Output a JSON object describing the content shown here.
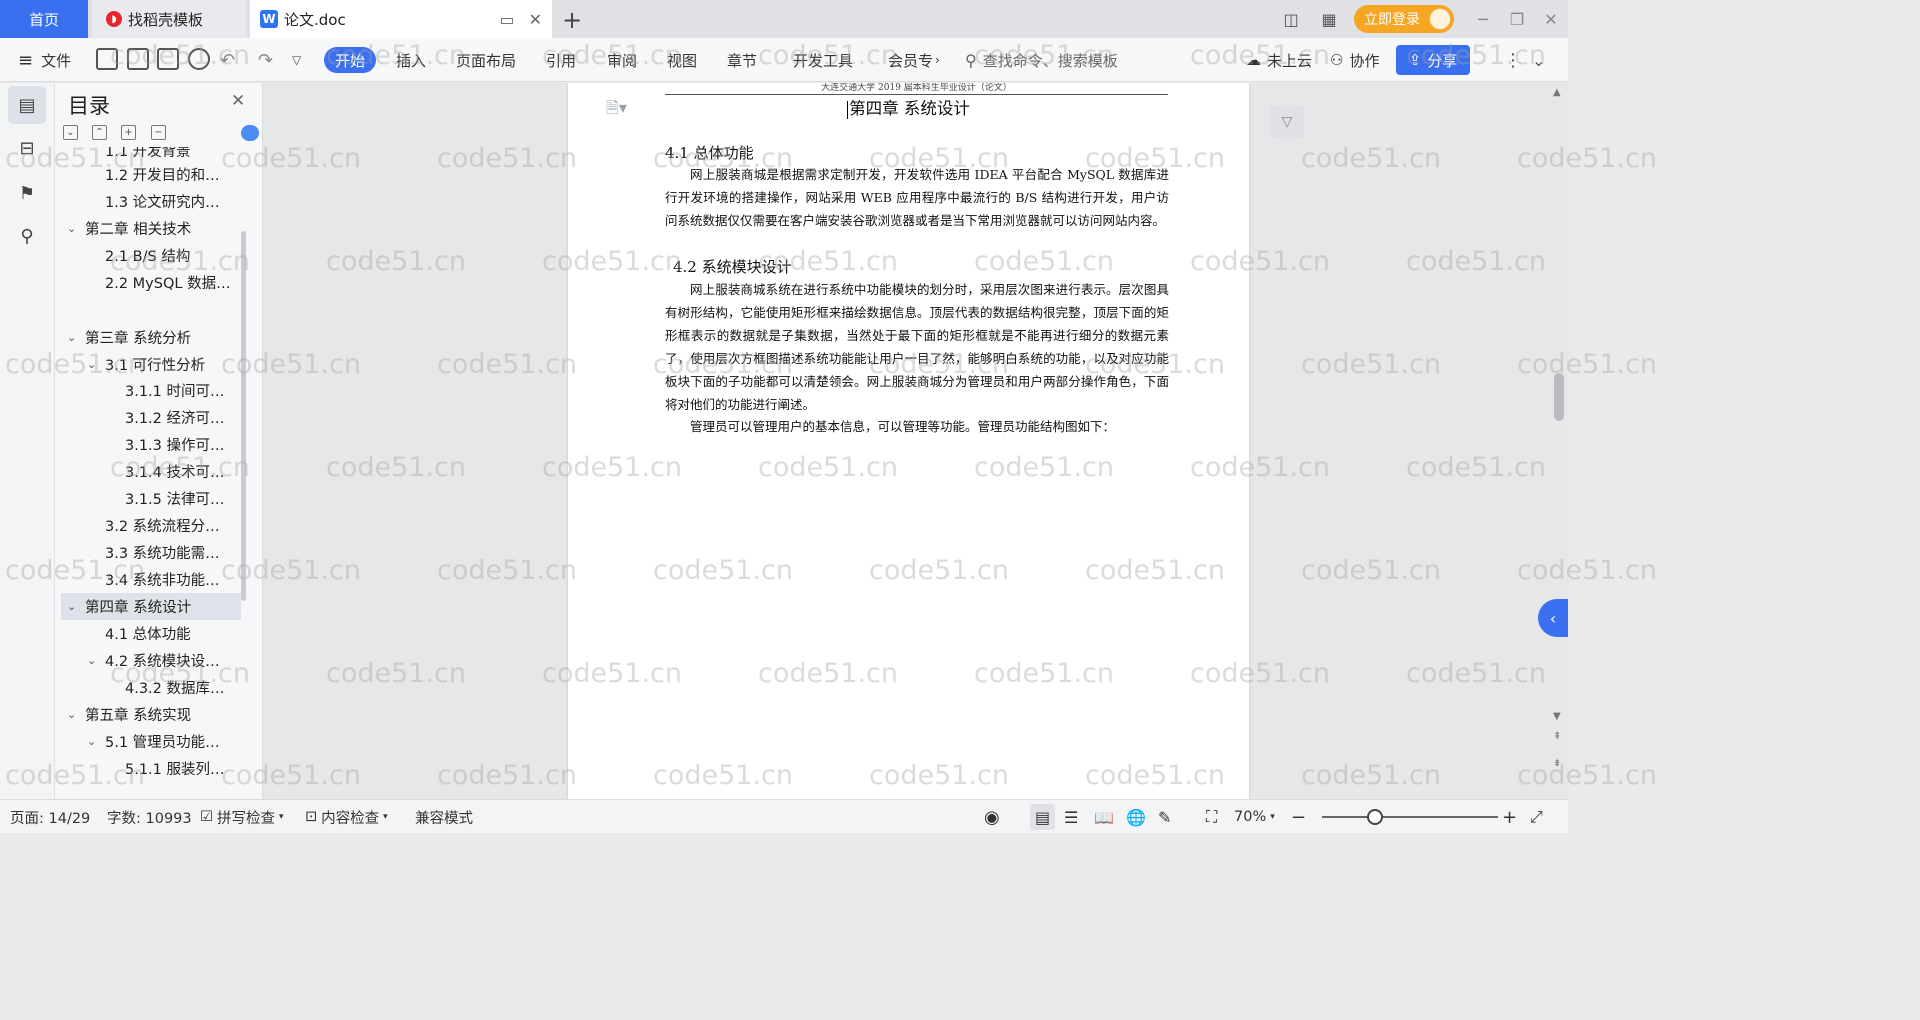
{
  "tabs": {
    "home": "首页",
    "daoke": "找稻壳模板",
    "doc": "论文.doc",
    "add": "+"
  },
  "account": {
    "login": "立即登录"
  },
  "menu": {
    "file": "文件",
    "start": "开始",
    "insert": "插入",
    "layout": "页面布局",
    "reference": "引用",
    "review": "审阅",
    "view": "视图",
    "chapter": "章节",
    "devtools": "开发工具",
    "member": "会员专",
    "search_placeholder": "查找命令、搜索模板",
    "cloud": "未上云",
    "collab": "协作",
    "share": "分享"
  },
  "toc": {
    "title": "目录",
    "items": [
      {
        "label": "1.1 开发背景",
        "level": 2
      },
      {
        "label": "1.2 开发目的和…",
        "level": 2
      },
      {
        "label": "1.3 论文研究内…",
        "level": 2
      },
      {
        "label": "第二章 相关技术",
        "level": 1
      },
      {
        "label": "2.1 B/S 结构",
        "level": 2
      },
      {
        "label": "2.2 MySQL 数据…",
        "level": 2
      },
      {
        "label": "第三章 系统分析",
        "level": 1
      },
      {
        "label": "3.1 可行性分析",
        "level": 2
      },
      {
        "label": "3.1.1 时间可…",
        "level": 3
      },
      {
        "label": "3.1.2 经济可…",
        "level": 3
      },
      {
        "label": "3.1.3 操作可…",
        "level": 3
      },
      {
        "label": "3.1.4 技术可…",
        "level": 3
      },
      {
        "label": "3.1.5 法律可…",
        "level": 3
      },
      {
        "label": "3.2 系统流程分…",
        "level": 2
      },
      {
        "label": "3.3 系统功能需…",
        "level": 2
      },
      {
        "label": "3.4 系统非功能…",
        "level": 2
      },
      {
        "label": "第四章 系统设计",
        "level": 1
      },
      {
        "label": "4.1 总体功能",
        "level": 2
      },
      {
        "label": "4.2 系统模块设…",
        "level": 2
      },
      {
        "label": "4.3.2 数据库…",
        "level": 3
      },
      {
        "label": "第五章 系统实现",
        "level": 1
      },
      {
        "label": "5.1 管理员功能…",
        "level": 2
      },
      {
        "label": "5.1.1 服装列…",
        "level": 3
      }
    ]
  },
  "document": {
    "header": "大连交通大学 2019 届本科生毕业设计（论文）",
    "chapter_title": "第四章  系统设计",
    "sec_4_1": "4.1  总体功能",
    "para_4_1": "网上服装商城是根据需求定制开发，开发软件选用 IDEA 平台配合 MySQL 数据库进行开发环境的搭建操作，网站采用 WEB 应用程序中最流行的 B/S 结构进行开发，用户访问系统数据仅仅需要在客户端安装谷歌浏览器或者是当下常用浏览器就可以访问网站内容。",
    "sec_4_2": "4.2  系统模块设计",
    "para_4_2": "网上服装商城系统在进行系统中功能模块的划分时，采用层次图来进行表示。层次图具有树形结构，它能使用矩形框来描绘数据信息。顶层代表的数据结构很完整，顶层下面的矩形框表示的数据就是子集数据，当然处于最下面的矩形框就是不能再进行细分的数据元素了，使用层次方框图描述系统功能能让用户一目了然，能够明白系统的功能，以及对应功能板块下面的子功能都可以清楚领会。网上服装商城分为管理员和用户两部分操作角色，下面将对他们的功能进行阐述。",
    "para_admin": "管理员可以管理用户的基本信息，可以管理等功能。管理员功能结构图如下："
  },
  "watermark_text": "code51.cn",
  "status": {
    "page": "页面: 14/29",
    "words": "字数: 10993",
    "spell": "拼写检查",
    "content_check": "内容检查",
    "compat": "兼容模式",
    "zoom": "70%"
  }
}
